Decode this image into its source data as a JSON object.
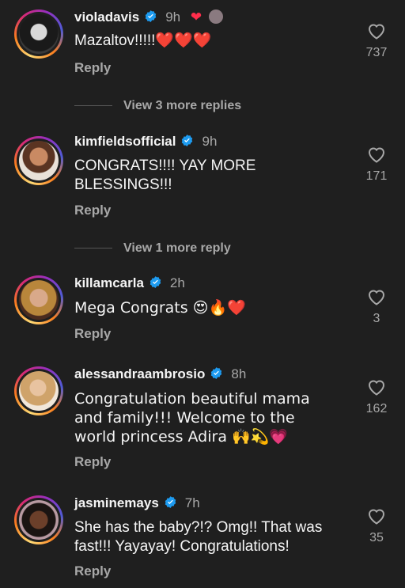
{
  "comments": [
    {
      "username": "violadavis",
      "time": "9h",
      "text": "Mazaltov!!!!!❤️❤️❤️",
      "reply": "Reply",
      "likes": "737",
      "verified": true,
      "icon": "heart-outline-icon"
    },
    {
      "username": "kimfieldsofficial",
      "time": "9h",
      "text": "CONGRATS!!!! YAY MORE BLESSINGS!!!",
      "reply": "Reply",
      "likes": "171",
      "verified": true
    },
    {
      "username": "killamcarla",
      "time": "2h",
      "text": "Mega Congrats 😍🔥❤️",
      "reply": "Reply",
      "likes": "3",
      "verified": true
    },
    {
      "username": "alessandraambrosio",
      "time": "8h",
      "text": "Congratulation beautiful mama and family!!! Welcome to the world princess Adira 🙌💫💗",
      "reply": "Reply",
      "likes": "162",
      "verified": true
    },
    {
      "username": "jasminemays",
      "time": "7h",
      "text": "She has the baby?!? Omg!! That was fast!!! Yayayay! Congratulations!",
      "reply": "Reply",
      "likes": "35",
      "verified": true
    }
  ],
  "view_more": [
    {
      "label": "View 3 more replies"
    },
    {
      "label": "View 1 more reply"
    }
  ],
  "colors": {
    "background": "#1f1f1f",
    "text": "#f5f5f5",
    "secondary": "#a8a8a8",
    "verified": "#1d9bf0",
    "heart_red": "#ff2d4b"
  }
}
